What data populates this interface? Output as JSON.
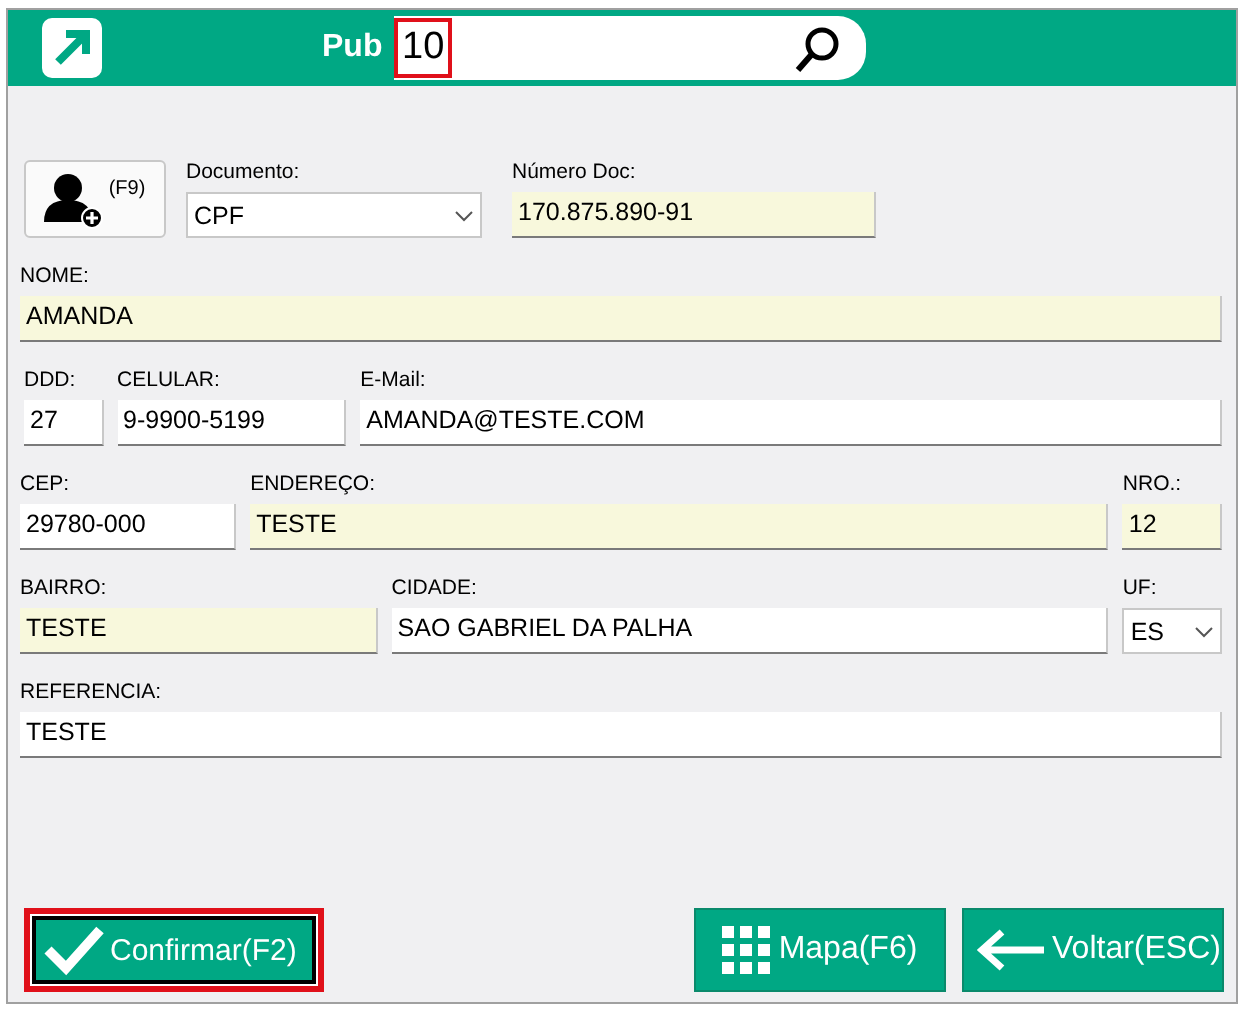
{
  "header": {
    "label": "Pub",
    "search": {
      "value": "10",
      "highlighted": true
    }
  },
  "photo_button": {
    "label": "(F9)"
  },
  "rows": [
    [
      {
        "kind": "select",
        "label": "Documento:",
        "value": "CPF",
        "required": false
      },
      {
        "kind": "text",
        "label": "Número Doc:",
        "value": "170.875.890-91",
        "required": true
      }
    ],
    [
      {
        "kind": "text",
        "label": "NOME:",
        "value": "AMANDA",
        "required": true
      }
    ],
    [
      {
        "kind": "text",
        "label": "DDD:",
        "value": "27",
        "required": false
      },
      {
        "kind": "text",
        "label": "CELULAR:",
        "value": "9-9900-5199",
        "required": false
      },
      {
        "kind": "text",
        "label": "E-Mail:",
        "value": "AMANDA@TESTE.COM",
        "required": false
      }
    ],
    [
      {
        "kind": "text",
        "label": "CEP:",
        "value": "29780-000",
        "required": false
      },
      {
        "kind": "text",
        "label": "ENDEREÇO:",
        "value": "TESTE",
        "required": true
      },
      {
        "kind": "text",
        "label": "NRO.:",
        "value": "12",
        "required": true
      }
    ],
    [
      {
        "kind": "text",
        "label": "BAIRRO:",
        "value": "TESTE",
        "required": true
      },
      {
        "kind": "text",
        "label": "CIDADE:",
        "value": "SAO GABRIEL DA PALHA",
        "required": false
      },
      {
        "kind": "select",
        "label": "UF:",
        "value": "ES",
        "required": false
      }
    ],
    [
      {
        "kind": "text",
        "label": "REFERENCIA:",
        "value": "TESTE",
        "required": false
      }
    ]
  ],
  "buttons": [
    {
      "kind": "confirm",
      "label": "Confirmar(F2)",
      "highlighted": true
    },
    {
      "kind": "map",
      "label": "Mapa(F6)",
      "highlighted": false
    },
    {
      "kind": "back",
      "label": "Voltar(ESC)",
      "highlighted": false
    }
  ]
}
